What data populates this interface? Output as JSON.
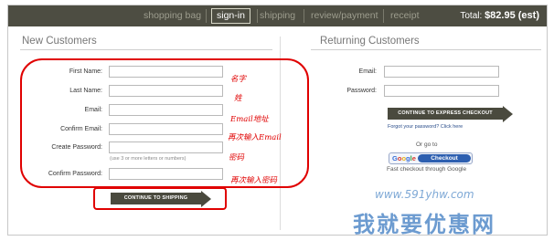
{
  "nav": {
    "steps": [
      "shopping bag",
      "sign-in",
      "shipping",
      "review/payment",
      "receipt"
    ],
    "active": "sign-in",
    "total_label": "Total:",
    "total_value": "$82.95 (est)"
  },
  "new_customers": {
    "title": "New Customers",
    "fields": [
      {
        "label": "First Name:",
        "value": ""
      },
      {
        "label": "Last Name:",
        "value": ""
      },
      {
        "label": "Email:",
        "value": ""
      },
      {
        "label": "Confirm Email:",
        "value": ""
      },
      {
        "label": "Create Password:",
        "value": ""
      },
      {
        "label": "Confirm Password:",
        "value": ""
      }
    ],
    "password_hint": "(use 3 or more letters or numbers)",
    "continue_button": "CONTINUE TO SHIPPING"
  },
  "annotations": [
    "名字",
    "姓",
    "Email地址",
    "再次输入Email",
    "密码",
    "再次输入密码"
  ],
  "returning_customers": {
    "title": "Returning Customers",
    "email_label": "Email:",
    "password_label": "Password:",
    "email_value": "",
    "password_value": "",
    "express_button": "CONTINUE TO EXPRESS CHECKOUT",
    "forgot_text": "Forgot your password?",
    "click_here": "Click here",
    "or_go_to": "Or go to",
    "google_label": "Google",
    "checkout_label": "Checkout",
    "fast_checkout": "Fast checkout through Google"
  },
  "watermark": {
    "url": "www.591yhw.com",
    "name": "我就要优惠网"
  },
  "colors": {
    "nav_bg": "#4d4d42",
    "button_bg": "#4a4a3e",
    "annotation_red": "#e00000",
    "link_blue": "#2a4d8a"
  }
}
